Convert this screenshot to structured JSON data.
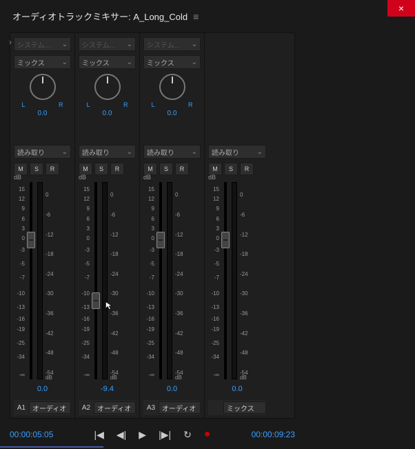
{
  "window": {
    "close": "×"
  },
  "panel": {
    "title": "オーディオトラックミキサー: A_Long_Cold",
    "menu": "≡"
  },
  "common": {
    "system_label": "システム...",
    "mix_label": "ミックス",
    "knob_L": "L",
    "knob_R": "R",
    "automation_label": "読み取り",
    "btn_M": "M",
    "btn_S": "S",
    "btn_R": "R",
    "db_label": "dB",
    "chev": "⌄",
    "scale_left": [
      "15",
      "12",
      "9",
      "6",
      "3",
      "0",
      "-3",
      "-5",
      "-7",
      "-10",
      "-13",
      "-16",
      "-19",
      "-25",
      "-34",
      "-∞"
    ],
    "scale_left_pos": [
      2,
      7,
      12,
      17,
      22,
      27,
      33,
      40,
      47,
      55,
      62,
      68,
      73,
      80,
      87,
      96
    ],
    "scale_right": [
      "0",
      "-6",
      "-12",
      "-18",
      "-24",
      "-30",
      "-36",
      "-42",
      "-48",
      "-54"
    ],
    "scale_right_pos": [
      5,
      15,
      25,
      35,
      45,
      55,
      65,
      75,
      85,
      95
    ]
  },
  "tracks": [
    {
      "id": "A1",
      "name": "オーディオ",
      "pan": "0.0",
      "vol": "0.0",
      "thumb": 25,
      "master": false
    },
    {
      "id": "A2",
      "name": "オーディオ",
      "pan": "0.0",
      "vol": "-9.4",
      "thumb": 56,
      "master": false
    },
    {
      "id": "A3",
      "name": "オーディオ",
      "pan": "0.0",
      "vol": "0.0",
      "thumb": 25,
      "master": false
    },
    {
      "id": "",
      "name": "ミックス",
      "pan": "",
      "vol": "0.0",
      "thumb": 25,
      "master": true
    }
  ],
  "transport": {
    "left_time": "00:00:05:05",
    "right_time": "00:00:09:23",
    "btn_go_start": "|◀",
    "btn_step_back": "◀|",
    "btn_play": "▶",
    "btn_step_fwd": "|▶|",
    "btn_loop": "↻",
    "btn_record": "●"
  }
}
